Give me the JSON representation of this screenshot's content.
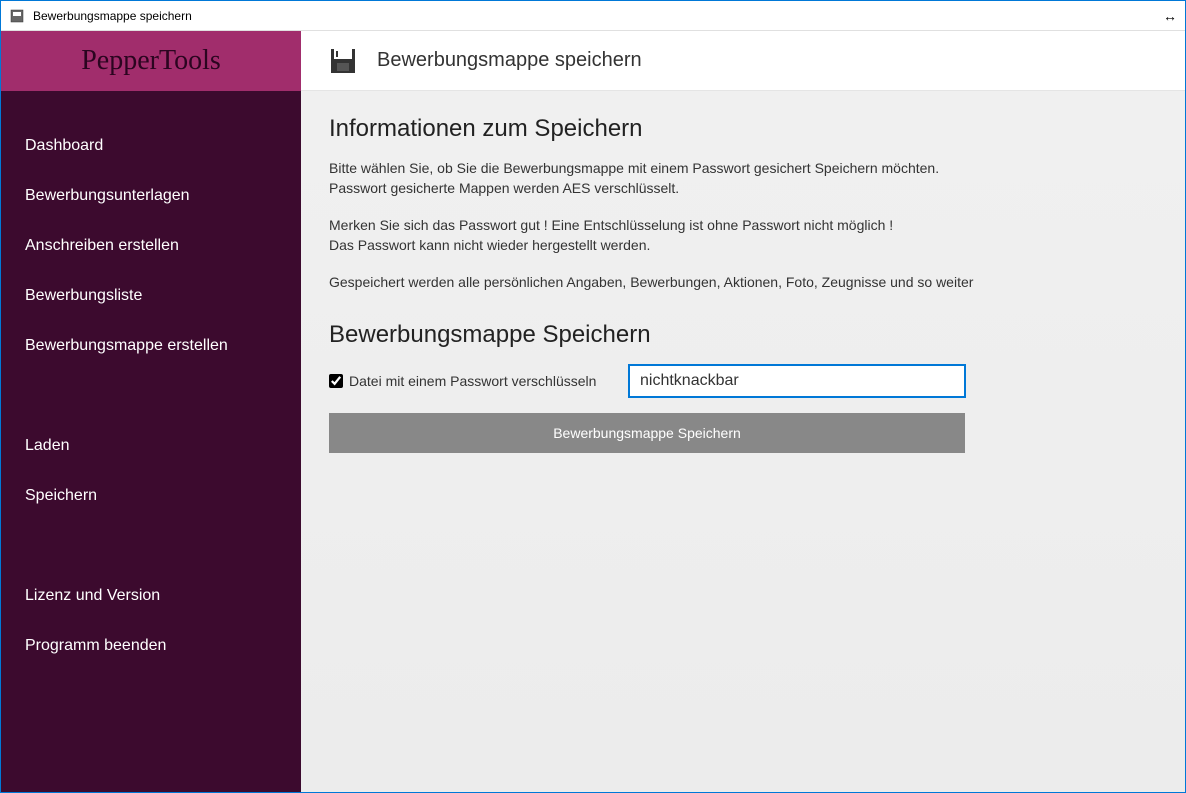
{
  "window": {
    "title": "Bewerbungsmappe speichern"
  },
  "sidebar": {
    "logo": "PepperTools",
    "items": [
      {
        "label": "Dashboard"
      },
      {
        "label": "Bewerbungsunterlagen"
      },
      {
        "label": "Anschreiben erstellen"
      },
      {
        "label": "Bewerbungsliste"
      },
      {
        "label": "Bewerbungsmappe erstellen"
      }
    ],
    "group2": [
      {
        "label": "Laden"
      },
      {
        "label": "Speichern"
      }
    ],
    "group3": [
      {
        "label": "Lizenz und Version"
      },
      {
        "label": "Programm beenden"
      }
    ]
  },
  "header": {
    "title": "Bewerbungsmappe speichern"
  },
  "content": {
    "info_heading": "Informationen zum Speichern",
    "info_p1_l1": "Bitte wählen Sie, ob Sie die Bewerbungsmappe mit einem Passwort gesichert Speichern möchten.",
    "info_p1_l2": "Passwort gesicherte Mappen werden AES verschlüsselt.",
    "info_p2_l1": "Merken Sie sich das Passwort gut ! Eine Entschlüsselung ist ohne Passwort nicht möglich !",
    "info_p2_l2": "Das Passwort kann nicht wieder hergestellt werden.",
    "info_p3": "Gespeichert werden alle persönlichen Angaben, Bewerbungen, Aktionen, Foto, Zeugnisse und so weiter",
    "save_heading": "Bewerbungsmappe Speichern",
    "checkbox_label": "Datei mit einem Passwort verschlüsseln",
    "checkbox_checked": true,
    "password_value": "nichtknackbar",
    "save_button": "Bewerbungsmappe Speichern"
  }
}
